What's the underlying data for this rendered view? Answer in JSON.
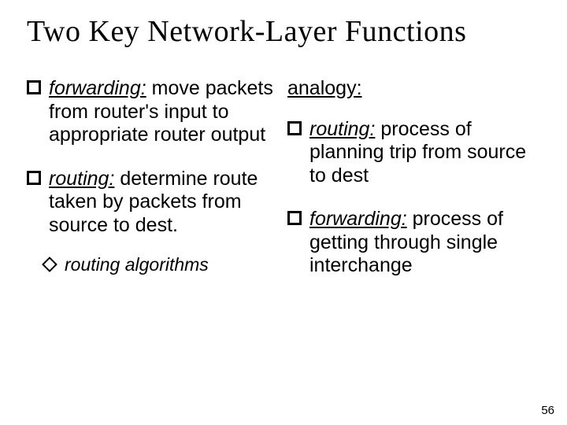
{
  "title": "Two Key Network-Layer Functions",
  "left": {
    "b1": {
      "keyword": "forwarding:",
      "rest": " move packets from router's input to appropriate router output"
    },
    "b2": {
      "keyword": "routing:",
      "rest": " determine route taken by packets from source to dest."
    },
    "sub": {
      "text": "routing algorithms"
    }
  },
  "right": {
    "heading": "analogy:",
    "b1": {
      "keyword": "routing:",
      "rest": " process of planning trip from source to dest"
    },
    "b2": {
      "keyword": "forwarding:",
      "rest": " process of getting through single interchange"
    }
  },
  "page": "56"
}
